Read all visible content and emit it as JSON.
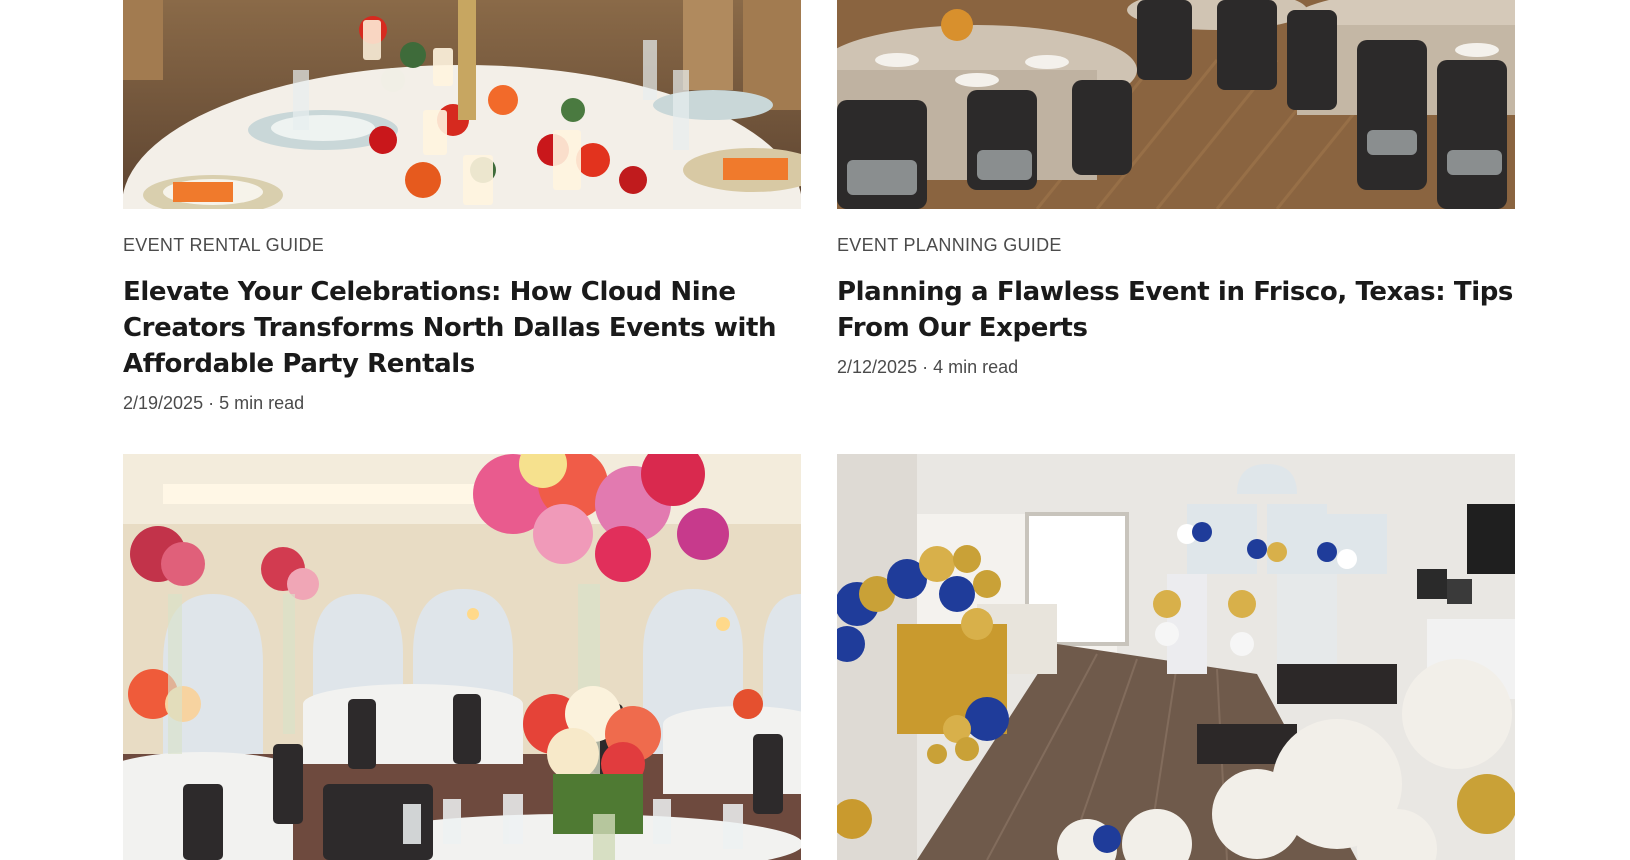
{
  "posts": [
    {
      "category": "EVENT RENTAL GUIDE",
      "title": "Elevate Your Celebrations: How Cloud Nine Creators Transforms North Dallas Events with Affordable Party Rentals",
      "date": "2/19/2025",
      "read_time": "5 min read",
      "meta": "2/19/2025 · 5 min read",
      "image": "banquet-table-centerpiece-image"
    },
    {
      "category": "EVENT PLANNING GUIDE",
      "title": "Planning a Flawless Event in Frisco, Texas: Tips From Our Experts",
      "date": "2/12/2025",
      "read_time": "4 min read",
      "meta": "2/12/2025 · 4 min read",
      "image": "round-tables-chairs-image"
    },
    {
      "category": "",
      "title": "",
      "meta": "",
      "image": "ballroom-floral-centerpiece-image"
    },
    {
      "category": "",
      "title": "",
      "meta": "",
      "image": "balloon-decor-room-image"
    }
  ],
  "colors": {
    "text_primary": "#1a1a1a",
    "text_secondary": "#4b4b4b",
    "background": "#ffffff"
  }
}
